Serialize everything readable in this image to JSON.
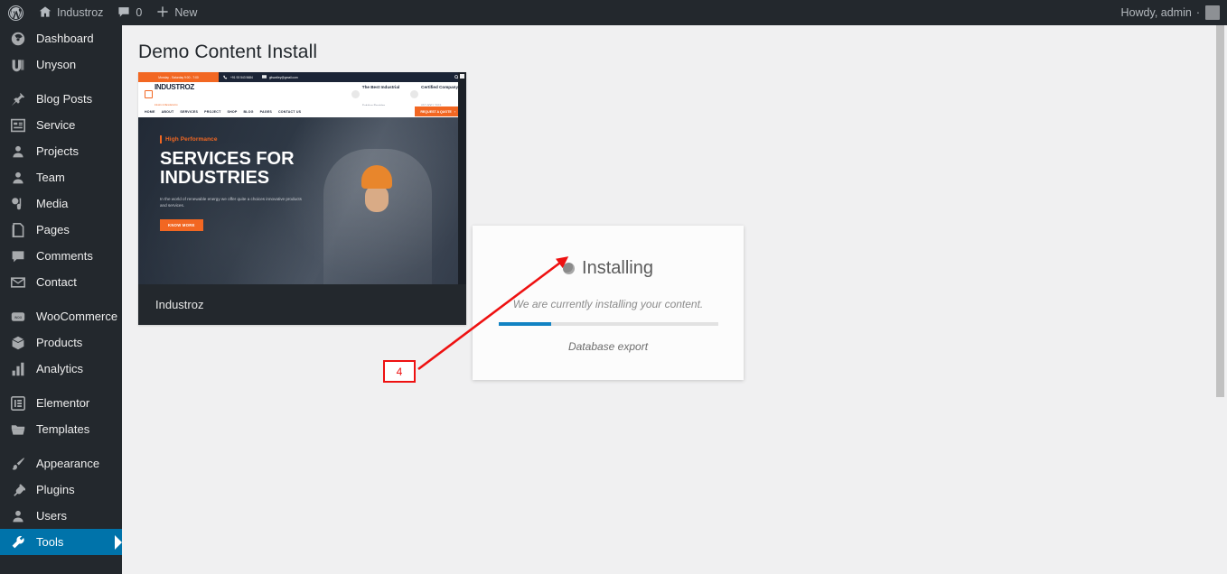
{
  "adminbar": {
    "logo_icon": "wordpress-logo-icon",
    "site_icon": "home-icon",
    "site_name": "Industroz",
    "comments_icon": "comment-bubble-icon",
    "comments_count": "0",
    "new_icon": "plus-icon",
    "new_label": "New",
    "howdy": "Howdy, admin",
    "howdy_caret": "·"
  },
  "sidebar": {
    "items": [
      {
        "label": "Dashboard",
        "icon": "dashboard-icon",
        "active": false,
        "sep_after": false
      },
      {
        "label": "Unyson",
        "icon": "unyson-icon",
        "active": false,
        "sep_after": true
      },
      {
        "label": "Blog Posts",
        "icon": "pin-icon",
        "active": false,
        "sep_after": false
      },
      {
        "label": "Service",
        "icon": "grid-icon",
        "active": false,
        "sep_after": false
      },
      {
        "label": "Projects",
        "icon": "user-icon",
        "active": false,
        "sep_after": false
      },
      {
        "label": "Team",
        "icon": "user-icon",
        "active": false,
        "sep_after": false
      },
      {
        "label": "Media",
        "icon": "media-icon",
        "active": false,
        "sep_after": false
      },
      {
        "label": "Pages",
        "icon": "pages-icon",
        "active": false,
        "sep_after": false
      },
      {
        "label": "Comments",
        "icon": "comment-bubble-icon",
        "active": false,
        "sep_after": false
      },
      {
        "label": "Contact",
        "icon": "envelope-icon",
        "active": false,
        "sep_after": true
      },
      {
        "label": "WooCommerce",
        "icon": "woocommerce-icon",
        "active": false,
        "sep_after": false
      },
      {
        "label": "Products",
        "icon": "product-box-icon",
        "active": false,
        "sep_after": false
      },
      {
        "label": "Analytics",
        "icon": "bar-chart-icon",
        "active": false,
        "sep_after": true
      },
      {
        "label": "Elementor",
        "icon": "elementor-icon",
        "active": false,
        "sep_after": false
      },
      {
        "label": "Templates",
        "icon": "folder-icon",
        "active": false,
        "sep_after": true
      },
      {
        "label": "Appearance",
        "icon": "paintbrush-icon",
        "active": false,
        "sep_after": false
      },
      {
        "label": "Plugins",
        "icon": "plug-icon",
        "active": false,
        "sep_after": false
      },
      {
        "label": "Users",
        "icon": "user-icon",
        "active": false,
        "sep_after": false
      },
      {
        "label": "Tools",
        "icon": "wrench-icon",
        "active": true,
        "sep_after": false
      }
    ]
  },
  "page": {
    "title": "Demo Content Install"
  },
  "theme_card": {
    "name": "Industroz",
    "preview": {
      "topbar": {
        "hours": "Monday - Saturday 9:00 - 7:00",
        "phone_icon": "phone-icon",
        "phone": "+91 93 543 5684",
        "email_icon": "envelope-icon",
        "email": "gitswdley@gmail.com",
        "search_icon": "search-icon"
      },
      "logo": {
        "mark": "factory-icon",
        "text": "INDUSTROZ",
        "tagline": "Industry & Manufacturing"
      },
      "features": [
        {
          "icon": "trophy-icon",
          "line1": "The Best Industrial",
          "line2": "Solution Provider"
        },
        {
          "icon": "badge-icon",
          "line1": "Certified Company",
          "line2": "ISO 9001 2015"
        }
      ],
      "nav": [
        "HOME",
        "ABOUT",
        "SERVICES",
        "PROJECT",
        "SHOP",
        "BLOG",
        "PAGES",
        "CONTACT US"
      ],
      "quote_button": "REQUEST A QUOTE",
      "quote_arrow": "›",
      "hero": {
        "tagline": "High Performance",
        "heading_line1": "SERVICES FOR",
        "heading_line2": "INDUSTRIES",
        "paragraph": "In the world of renewable energy we offer quite a choices innovative products and services.",
        "button": "KNOW MORE"
      }
    }
  },
  "modal": {
    "title": "Installing",
    "spinner_icon": "spinner-icon",
    "subtitle": "We are currently installing your content.",
    "progress_percent": 24,
    "current_step": "Database export"
  },
  "annotation": {
    "marker_label": "4",
    "arrow_color": "#ee1111"
  },
  "colors": {
    "admin_dark": "#23282d",
    "accent_blue": "#0073aa",
    "progress_blue": "#1283c3",
    "theme_orange": "#f26722",
    "annotation_red": "#ee1111"
  }
}
